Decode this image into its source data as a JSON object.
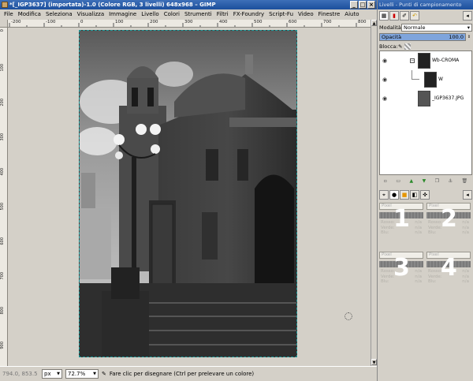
{
  "window": {
    "title": "*[_IGP3637] (importata)-1.0 (Colore RGB, 3 livelli) 648x968 – GIMP",
    "controls": [
      "_",
      "□",
      "×"
    ]
  },
  "menu": [
    "File",
    "Modifica",
    "Seleziona",
    "Visualizza",
    "Immagine",
    "Livello",
    "Colori",
    "Strumenti",
    "Filtri",
    "FX-Foundry",
    "Script-Fu",
    "Video",
    "Finestre",
    "Aiuto"
  ],
  "ruler": {
    "h_labels": [
      "-200",
      "-100",
      "0",
      "100",
      "200",
      "300",
      "400",
      "500",
      "600",
      "700",
      "800"
    ],
    "v_labels": [
      "0",
      "100",
      "200",
      "300",
      "400",
      "500",
      "600",
      "700",
      "800",
      "900"
    ]
  },
  "status": {
    "coords": "794.0, 853.5",
    "unit": "px",
    "zoom": "72.7%",
    "message": "Fare clic per disegnare (Ctrl per prelevare un colore)"
  },
  "dock": {
    "title": "Livelli - Punti di campionamento",
    "mode_label": "Modalità:",
    "mode_value": "Normale",
    "opacity_label": "Opacità",
    "opacity_value": "100.0",
    "lock_label": "Blocca:",
    "layers": [
      {
        "name": "Wb-CROMA"
      },
      {
        "name": "W"
      },
      {
        "name": "_IGP3637.JPG"
      }
    ],
    "samples": [
      {
        "number": "1",
        "mode": "Pixel",
        "labels": [
          "Rosso:",
          "Verde:",
          "Blu:"
        ],
        "values": [
          "n/a",
          "n/a",
          "n/a"
        ]
      },
      {
        "number": "2",
        "mode": "Pixel",
        "labels": [
          "Rosso:",
          "Verde:",
          "Blu:"
        ],
        "values": [
          "n/a",
          "n/a",
          "n/a"
        ]
      },
      {
        "number": "3",
        "mode": "Pixel",
        "labels": [
          "Rosso:",
          "Verde:",
          "Blu:"
        ],
        "values": [
          "n/a",
          "n/a",
          "n/a"
        ]
      },
      {
        "number": "4",
        "mode": "Pixel",
        "labels": [
          "Rosso:",
          "Verde:",
          "Blu:"
        ],
        "values": [
          "n/a",
          "n/a",
          "n/a"
        ]
      }
    ]
  }
}
